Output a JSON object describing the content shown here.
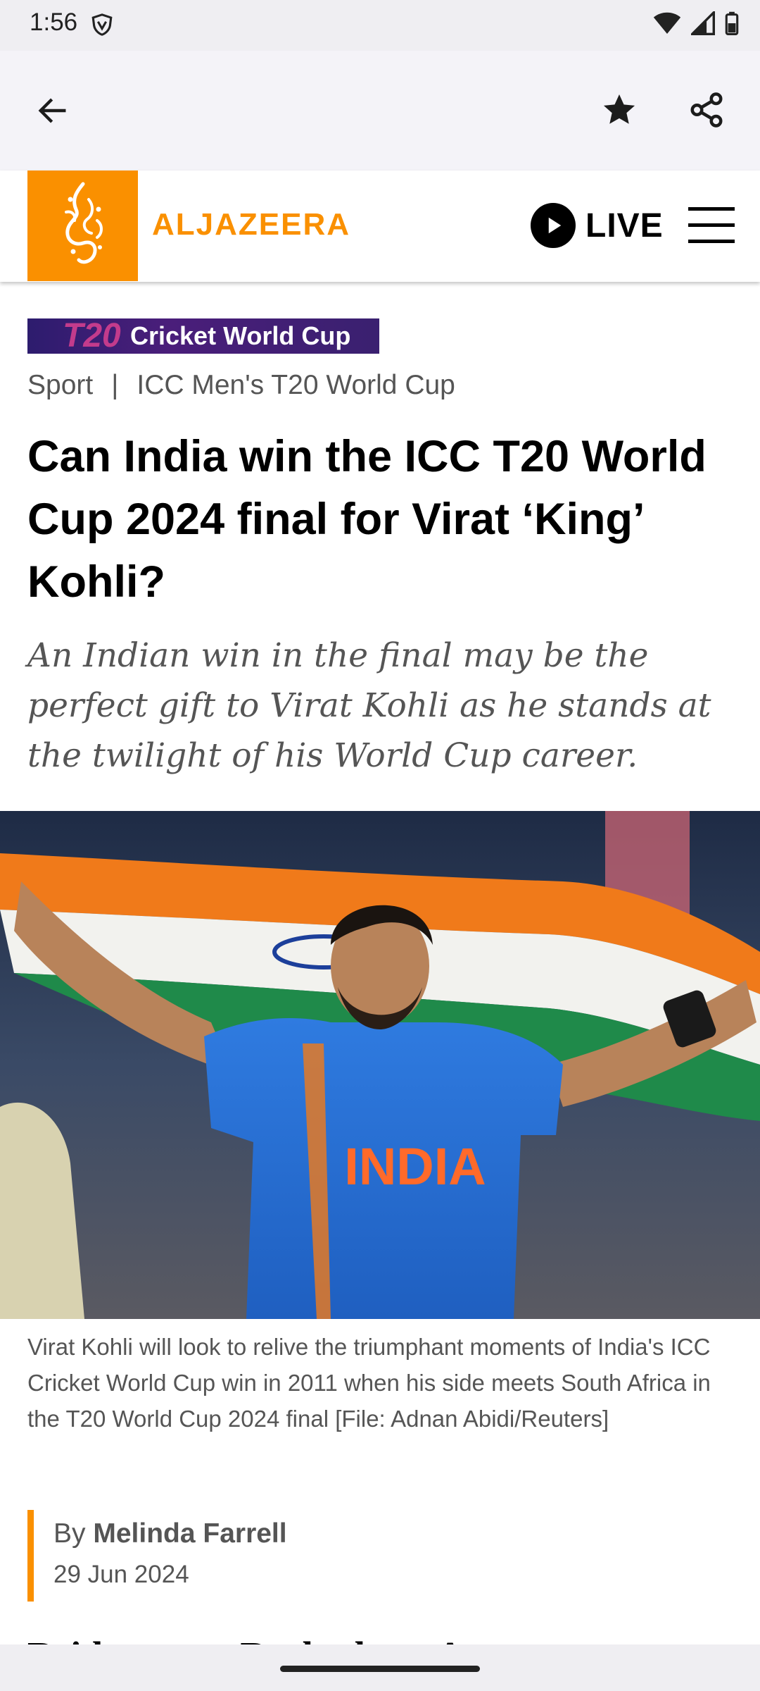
{
  "status_bar": {
    "time": "1:56"
  },
  "site": {
    "brand": "ALJAZEERA",
    "live_label": "LIVE"
  },
  "banner": {
    "mark": "T20",
    "label": "Cricket World Cup"
  },
  "breadcrumb": {
    "section": "Sport",
    "separator": "|",
    "topic": "ICC Men's T20 World Cup"
  },
  "article": {
    "headline": "Can India win the ICC T20 World Cup 2024 final for Virat ‘King’ Kohli?",
    "standfirst": "An Indian win in the final may be the perfect gift to Virat Kohli as he stands at the twilight of his World Cup career.",
    "image_jersey_text": "INDIA",
    "caption": "Virat Kohli will look to relive the triumphant moments of India's ICC Cricket World Cup win in 2011 when his side meets South Africa in the T20 World Cup 2024 final [File: Adnan Abidi/Reuters]",
    "byline_prefix": "By",
    "author": "Melinda Farrell",
    "date": "29 Jun 2024",
    "next_paragraph_fragment": "Bridgetown, Barbados – A…"
  },
  "icons": {
    "back": "arrow-left-icon",
    "bookmark": "star-icon",
    "share": "share-icon",
    "live": "play-icon",
    "menu": "hamburger-menu-icon"
  },
  "colors": {
    "brand_orange": "#fa9000",
    "status_bar_bg": "#efeef2",
    "app_bar_bg": "#f4f3f8"
  }
}
